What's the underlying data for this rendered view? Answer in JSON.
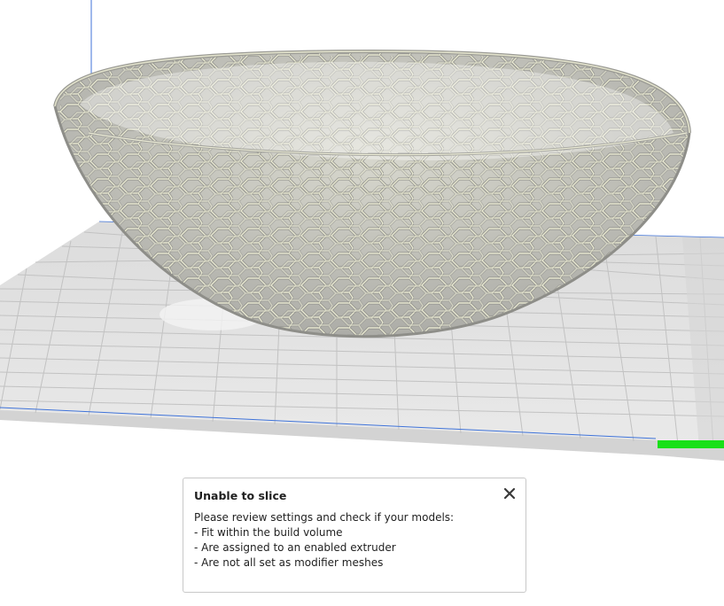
{
  "colors": {
    "plate_light": "#e6e6e6",
    "plate_shade": "#d7d7d7",
    "grid_line": "#c4c4c4",
    "axis_blue": "#3f73d9",
    "axis_green": "#18e018",
    "model_gray": "#b7b7b1",
    "model_highlight": "#e6e6cc"
  },
  "message": {
    "title": "Unable to slice",
    "intro": "Please review settings and check if your models:",
    "items": [
      "- Fit within the build volume",
      "- Are assigned to an enabled extruder",
      "- Are not all set as modifier meshes"
    ],
    "close_icon": "close-icon"
  }
}
